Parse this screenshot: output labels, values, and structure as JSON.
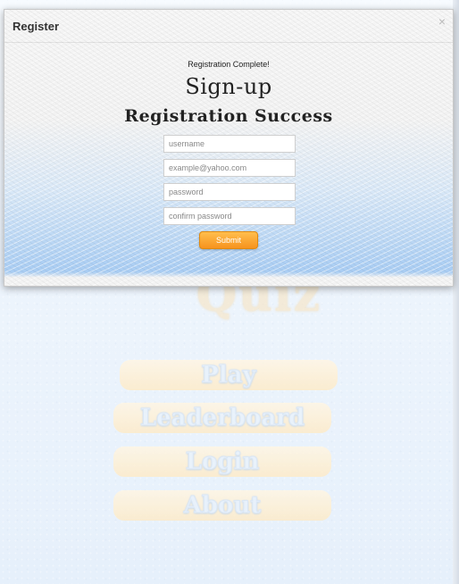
{
  "dialog": {
    "title": "Register",
    "close": "×",
    "message": "Registration Complete!",
    "heading": "Sign-up",
    "subheading": "Registration Success",
    "fields": {
      "username_placeholder": "username",
      "email_placeholder": "example@yahoo.com",
      "password_placeholder": "password",
      "confirm_placeholder": "confirm password"
    },
    "submit_label": "Submit"
  },
  "background": {
    "logo_text": "Quiz",
    "menu": [
      "Play",
      "Leaderboard",
      "Login",
      "About"
    ]
  },
  "colors": {
    "submit": "#f7931e",
    "menu_button": "#fdebc9",
    "dialog_gradient": "#a9cdf3"
  }
}
